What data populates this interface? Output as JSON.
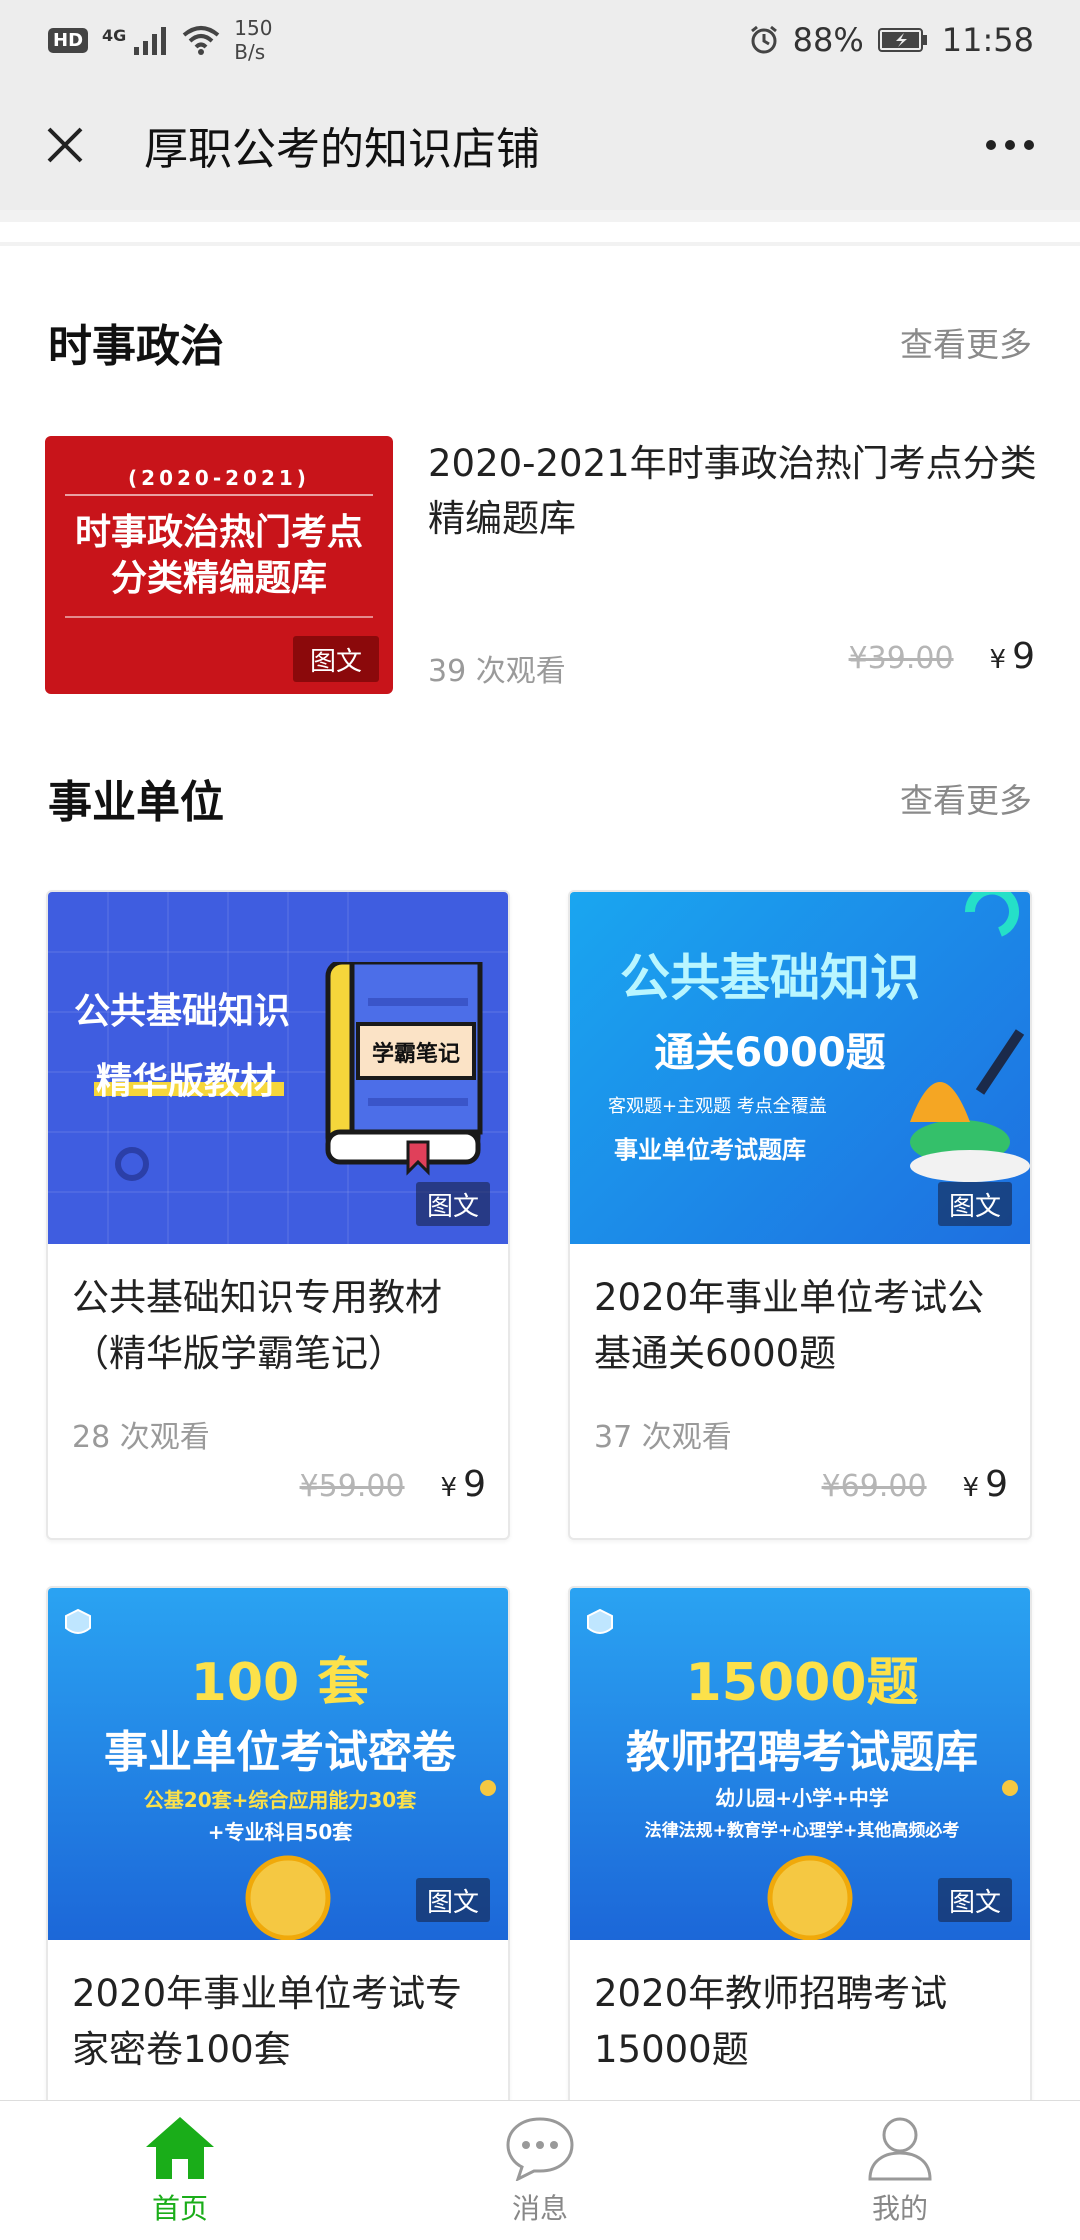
{
  "status_bar": {
    "hd": "HD",
    "network": "4G",
    "speed_value": "150",
    "speed_unit": "B/s",
    "battery": "88%",
    "time": "11:58"
  },
  "nav": {
    "title": "厚职公考的知识店铺"
  },
  "section_current_affairs": {
    "title": "时事政治",
    "more": "查看更多",
    "item": {
      "thumb_year": "(2020-2021)",
      "thumb_line1": "时事政治热门考点",
      "thumb_line2": "分类精编题库",
      "tag": "图文",
      "title": "2020-2021年时事政治热门考点分类精编题库",
      "views": "39 次观看",
      "old_price": "¥39.00",
      "yen": "¥",
      "price": "9"
    }
  },
  "section_institution": {
    "title": "事业单位",
    "more": "查看更多",
    "cards": [
      {
        "img_line1": "公共基础知识",
        "img_line2": "精华版教材",
        "img_book": "学霸笔记",
        "tag": "图文",
        "title": "公共基础知识专用教材（精华版学霸笔记）",
        "views": "28 次观看",
        "old_price": "¥59.00",
        "yen": "¥",
        "price": "9"
      },
      {
        "img_line1": "公共基础知识",
        "img_line2": "通关6000题",
        "img_line3": "客观题+主观题  考点全覆盖",
        "img_line4": "事业单位考试题库",
        "tag": "图文",
        "title": "2020年事业单位考试公基通关6000题",
        "views": "37 次观看",
        "old_price": "¥69.00",
        "yen": "¥",
        "price": "9"
      },
      {
        "img_line1": "100 套",
        "img_line2": "事业单位考试密卷",
        "img_line3": "公基20套+综合应用能力30套",
        "img_line4": "+专业科目50套",
        "tag": "图文",
        "title": "2020年事业单位考试专家密卷100套"
      },
      {
        "img_line1": "15000题",
        "img_line2": "教师招聘考试题库",
        "img_line3": "幼儿园+小学+中学",
        "img_line4": "法律法规+教育学+心理学+其他高频必考",
        "tag": "图文",
        "title": "2020年教师招聘考试15000题"
      }
    ]
  },
  "tabbar": {
    "home": "首页",
    "messages": "消息",
    "mine": "我的"
  },
  "colors": {
    "accent_green": "#1aad19",
    "thumb_red": "#c8141a",
    "card_blue": "#2f5fe0"
  }
}
